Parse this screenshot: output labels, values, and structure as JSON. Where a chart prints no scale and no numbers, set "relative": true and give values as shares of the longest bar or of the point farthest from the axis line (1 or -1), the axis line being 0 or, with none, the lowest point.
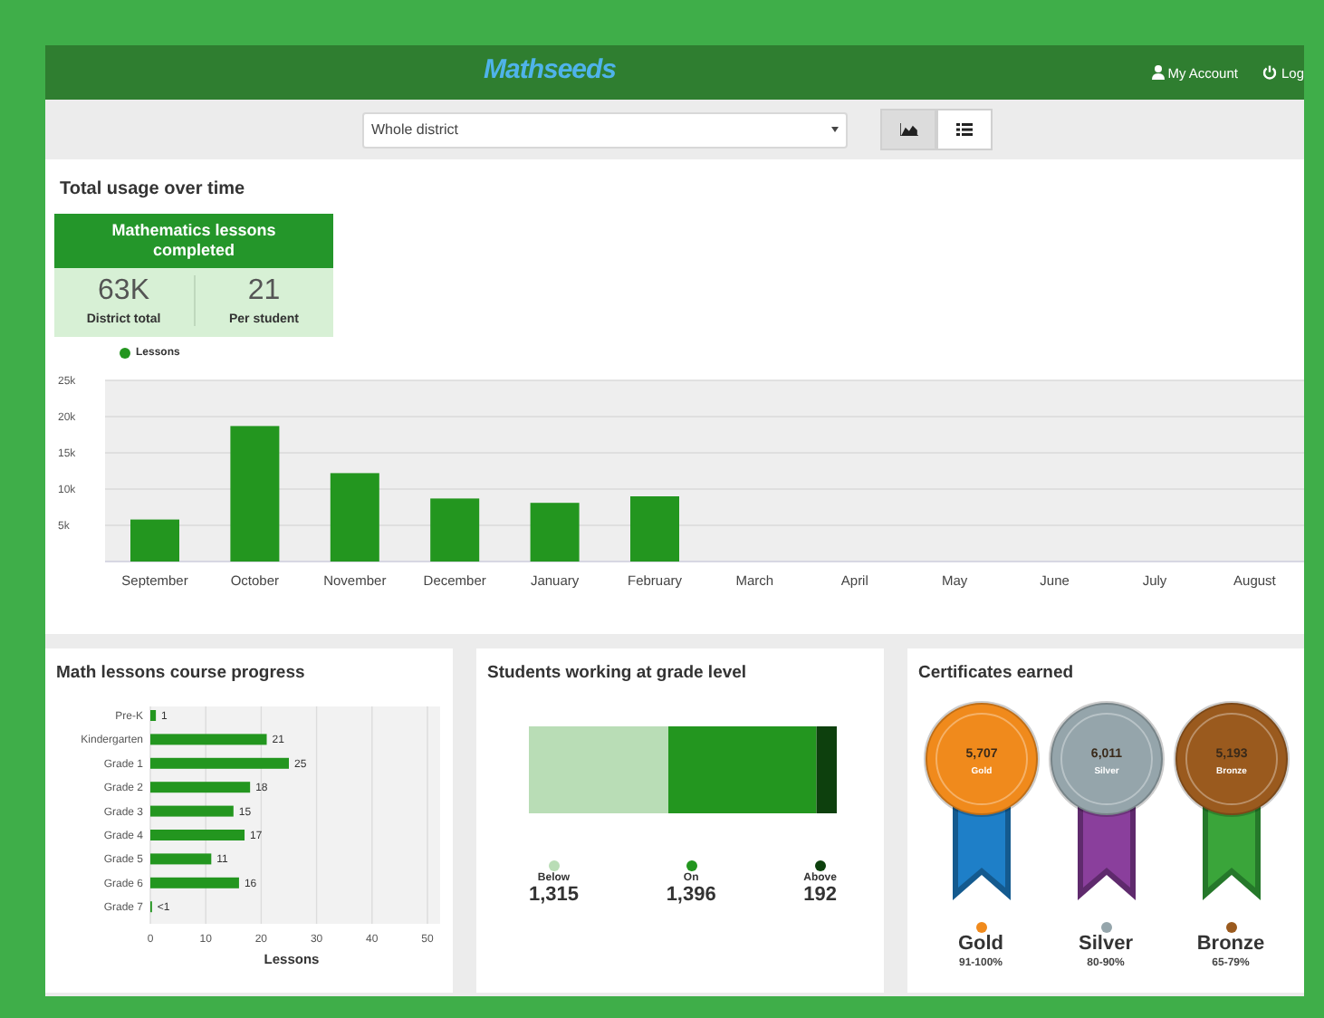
{
  "header": {
    "logo": "Mathseeds",
    "account": "My Account",
    "logout": "Log"
  },
  "toolbar": {
    "scope": "Whole district",
    "views": [
      {
        "kind": "chart",
        "selected": true
      },
      {
        "kind": "list",
        "selected": false
      }
    ]
  },
  "usage": {
    "title": "Total usage over time",
    "summary": {
      "heading": "Mathematics lessons completed",
      "stats": [
        {
          "value": "63K",
          "label": "District total"
        },
        {
          "value": "21",
          "label": "Per student"
        }
      ]
    },
    "chart_data": {
      "type": "bar",
      "categories": [
        "September",
        "October",
        "November",
        "December",
        "January",
        "February",
        "March",
        "April",
        "May",
        "June",
        "July",
        "August"
      ],
      "series": [
        {
          "name": "Lessons",
          "color": "#23961f",
          "values": [
            5800,
            18700,
            12200,
            8700,
            8100,
            9000,
            null,
            null,
            null,
            null,
            null,
            null
          ]
        }
      ],
      "grid": true,
      "ylim": [
        0,
        25000
      ],
      "yticks": [
        {
          "value": 5000,
          "label": "5k"
        },
        {
          "value": 10000,
          "label": "10k"
        },
        {
          "value": 15000,
          "label": "15k"
        },
        {
          "value": 20000,
          "label": "20k"
        },
        {
          "value": 25000,
          "label": "25k"
        }
      ]
    }
  },
  "progress": {
    "title": "Math lessons course progress",
    "chart_data": {
      "type": "bar",
      "orientation": "horizontal",
      "categories": [
        "Pre-K",
        "Kindergarten",
        "Grade 1",
        "Grade 2",
        "Grade 3",
        "Grade 4",
        "Grade 5",
        "Grade 6",
        "Grade 7"
      ],
      "series": [
        {
          "color": "#23961f",
          "values": [
            1,
            21,
            25,
            18,
            15,
            17,
            11,
            16,
            0.3
          ]
        }
      ],
      "grid": true,
      "xlabel": "Lessons",
      "xlim": [
        0,
        50
      ],
      "xticks": [
        0,
        10,
        20,
        30,
        40,
        50
      ],
      "value_labels": [
        "1",
        "21",
        "25",
        "18",
        "15",
        "17",
        "11",
        "16",
        "<1"
      ]
    }
  },
  "grade_level": {
    "title": "Students working at grade level",
    "chart_data": {
      "type": "bar",
      "orientation": "horizontal",
      "stacked": true,
      "relative": true,
      "legend": "bottom",
      "series": [
        {
          "name": "Below",
          "color": "#b9ddb6",
          "values": [
            0.453
          ]
        },
        {
          "name": "On",
          "color": "#23961f",
          "values": [
            0.481
          ]
        },
        {
          "name": "Above",
          "color": "#0d400d",
          "values": [
            0.066
          ]
        }
      ],
      "value_labels": [
        "1,315",
        "1,396",
        "192"
      ]
    }
  },
  "certificates": {
    "title": "Certificates earned",
    "medals": [
      {
        "count": "5,707",
        "badge_label": "Gold",
        "name": "Gold",
        "range": "91-100%",
        "color": "#f08a1c"
      },
      {
        "count": "6,011",
        "badge_label": "Silver",
        "name": "Silver",
        "range": "80-90%",
        "color": "#95a5ab"
      },
      {
        "count": "5,193",
        "badge_label": "Bronze",
        "name": "Bronze",
        "range": "65-79%",
        "color": "#9a5a1e"
      }
    ]
  }
}
